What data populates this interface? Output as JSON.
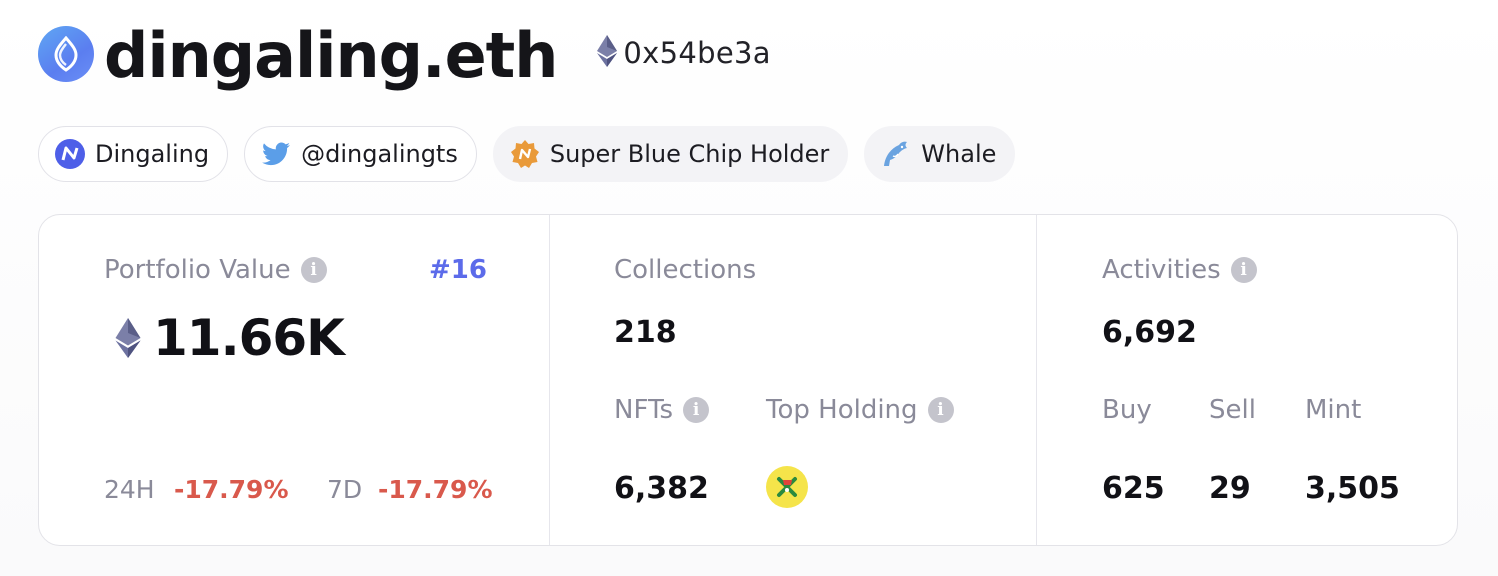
{
  "profile": {
    "name": "dingaling.eth",
    "address": "0x54be3a"
  },
  "tags": [
    {
      "label": "Dingaling",
      "icon": "nft-logo-icon"
    },
    {
      "label": "@dingalingts",
      "icon": "twitter-icon"
    },
    {
      "label": "Super Blue Chip Holder",
      "icon": "badge-icon"
    },
    {
      "label": "Whale",
      "icon": "whale-icon"
    }
  ],
  "portfolio": {
    "label": "Portfolio Value",
    "rank": "#16",
    "value": "11.66K",
    "change_24h_label": "24H",
    "change_24h": "-17.79%",
    "change_7d_label": "7D",
    "change_7d": "-17.79%"
  },
  "collections": {
    "label": "Collections",
    "value": "218",
    "nfts_label": "NFTs",
    "nfts_value": "6,382",
    "top_holding_label": "Top Holding"
  },
  "activities": {
    "label": "Activities",
    "value": "6,692",
    "buy_label": "Buy",
    "buy_value": "625",
    "sell_label": "Sell",
    "sell_value": "29",
    "mint_label": "Mint",
    "mint_value": "3,505"
  },
  "colors": {
    "accent": "#5c6bea",
    "negative": "#d9594c",
    "muted": "#8a8a99"
  }
}
